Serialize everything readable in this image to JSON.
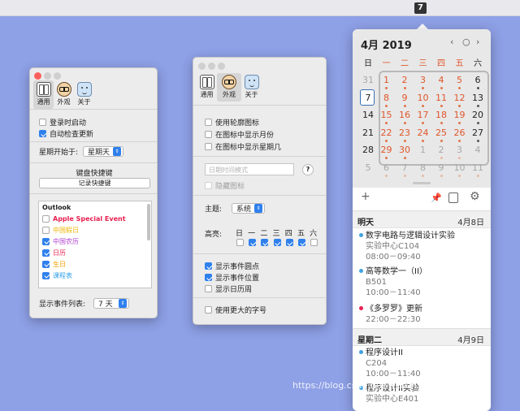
{
  "menubar": {
    "date_badge": "7"
  },
  "win1": {
    "tabs": [
      "通用",
      "外观",
      "关于"
    ],
    "launch_at_login": "登录时启动",
    "auto_update": "自动检查更新",
    "week_start_label": "星期开始于:",
    "week_start_value": "星期天",
    "shortcut_title": "键盘快捷键",
    "shortcut_button": "记录快捷键",
    "calendars": [
      {
        "name": "Outlook",
        "header": true
      },
      {
        "name": "Apple Special Event",
        "checked": false,
        "color": "#e8204f"
      },
      {
        "name": "中国假日",
        "checked": false,
        "color": "#f0b400"
      },
      {
        "name": "中国农历",
        "checked": true,
        "color": "#b03fd0"
      },
      {
        "name": "日历",
        "checked": true,
        "color": "#e8204f"
      },
      {
        "name": "生日",
        "checked": true,
        "color": "#f0a000"
      },
      {
        "name": "课程表",
        "checked": true,
        "color": "#2fa0e8"
      }
    ],
    "show_events_label": "显示事件列表:",
    "show_events_value": "7 天"
  },
  "win2": {
    "tabs": [
      "通用",
      "外观",
      "关于"
    ],
    "use_outline_icon": "使用轮廓图标",
    "show_month": "在图标中显示月份",
    "show_weekday": "在图标中显示星期几",
    "datetime_placeholder": "日期时间模式",
    "hide_icon": "隐藏图标",
    "theme_label": "主题:",
    "theme_value": "系统",
    "highlight_label": "高亮:",
    "weekdays": [
      "日",
      "一",
      "二",
      "三",
      "四",
      "五",
      "六"
    ],
    "highlight": [
      false,
      true,
      true,
      true,
      true,
      true,
      false
    ],
    "show_event_dots": "显示事件圆点",
    "show_event_location": "显示事件位置",
    "show_calendar_weeks": "显示日历周",
    "larger_text": "使用更大的字号"
  },
  "calendar": {
    "title": "4月 2019",
    "nav": [
      "‹",
      "○",
      "›"
    ],
    "weekdays": [
      "日",
      "一",
      "二",
      "三",
      "四",
      "五",
      "六"
    ],
    "weeks": [
      [
        {
          "d": "31",
          "t": "gray"
        },
        {
          "d": "1",
          "t": "red",
          "dot": true
        },
        {
          "d": "2",
          "t": "red",
          "dot": true
        },
        {
          "d": "3",
          "t": "red",
          "dot": true
        },
        {
          "d": "4",
          "t": "red",
          "dot": true
        },
        {
          "d": "5",
          "t": "red",
          "dot": true
        },
        {
          "d": "6",
          "t": "black",
          "dot": true
        }
      ],
      [
        {
          "d": "7",
          "t": "today"
        },
        {
          "d": "8",
          "t": "red",
          "dot": true
        },
        {
          "d": "9",
          "t": "red",
          "dot": true
        },
        {
          "d": "10",
          "t": "red",
          "dot": true
        },
        {
          "d": "11",
          "t": "red",
          "dot": true
        },
        {
          "d": "12",
          "t": "red",
          "dot": true
        },
        {
          "d": "13",
          "t": "black",
          "dot": true
        }
      ],
      [
        {
          "d": "14",
          "t": "black"
        },
        {
          "d": "15",
          "t": "red",
          "dot": true
        },
        {
          "d": "16",
          "t": "red",
          "dot": true
        },
        {
          "d": "17",
          "t": "red",
          "dot": true
        },
        {
          "d": "18",
          "t": "red",
          "dot": true
        },
        {
          "d": "19",
          "t": "red",
          "dot": true
        },
        {
          "d": "20",
          "t": "black",
          "dot": true
        }
      ],
      [
        {
          "d": "21",
          "t": "black"
        },
        {
          "d": "22",
          "t": "red",
          "dot": true
        },
        {
          "d": "23",
          "t": "red",
          "dot": true
        },
        {
          "d": "24",
          "t": "red",
          "dot": true
        },
        {
          "d": "25",
          "t": "red",
          "dot": true
        },
        {
          "d": "26",
          "t": "red",
          "dot": true
        },
        {
          "d": "27",
          "t": "black",
          "dot": true
        }
      ],
      [
        {
          "d": "28",
          "t": "black"
        },
        {
          "d": "29",
          "t": "red",
          "dot": true
        },
        {
          "d": "30",
          "t": "red",
          "dot": true
        },
        {
          "d": "1",
          "t": "gray"
        },
        {
          "d": "2",
          "t": "gray",
          "dot": true
        },
        {
          "d": "3",
          "t": "gray",
          "dot": true
        },
        {
          "d": "4",
          "t": "gray"
        }
      ],
      [
        {
          "d": "5",
          "t": "gray"
        },
        {
          "d": "6",
          "t": "gray",
          "dot": true
        },
        {
          "d": "7",
          "t": "gray",
          "dot": true
        },
        {
          "d": "8",
          "t": "gray",
          "dot": true
        },
        {
          "d": "9",
          "t": "gray",
          "dot": true
        },
        {
          "d": "10",
          "t": "gray",
          "dot": true
        },
        {
          "d": "11",
          "t": "gray",
          "dot": true
        }
      ]
    ],
    "icons": [
      "plus-icon",
      "pin-icon",
      "calendar-app-icon",
      "gear-icon"
    ]
  },
  "events": {
    "tomorrow": {
      "label": "明天",
      "date": "4月8日"
    },
    "tuesday": {
      "label": "星期二",
      "date": "4月9日"
    },
    "items": [
      {
        "title": "数字电路与逻辑设计实验",
        "loc": "实验中心C104",
        "time": "08:00－09:40",
        "color": "#3fa2e0"
      },
      {
        "title": "高等数学一（II）",
        "loc": "B501",
        "time": "10:00－11:40",
        "color": "#3fa2e0"
      },
      {
        "title": "《多罗罗》更新",
        "loc": "",
        "time": "22:00－22:30",
        "color": "#e8204f"
      },
      {
        "title": "程序设计II",
        "loc": "C204",
        "time": "10:00－11:40",
        "color": "#3fa2e0"
      },
      {
        "title": "程序设计II实验",
        "loc": "实验中心E401",
        "time": "",
        "color": "#3fa2e0"
      }
    ]
  },
  "colors": {
    "accent": "#2f80ed",
    "weekday_red": "#e0552a"
  },
  "watermark": "https://blog.csdn.net/weixin_44534381"
}
